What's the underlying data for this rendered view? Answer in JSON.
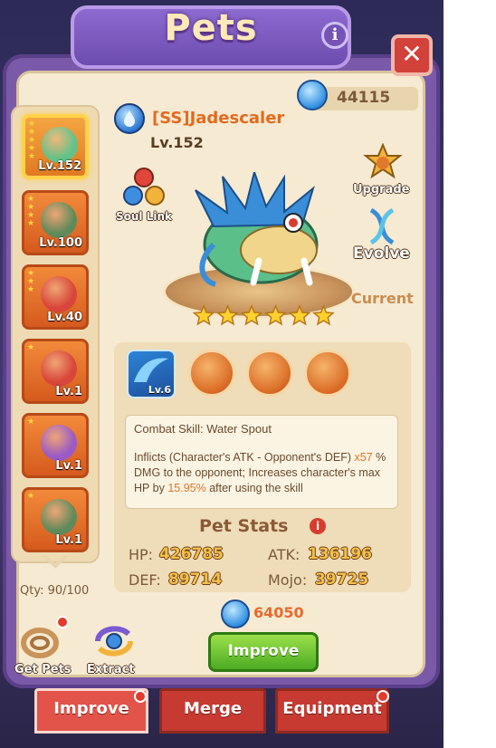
{
  "header": {
    "title": "Pets"
  },
  "currency": {
    "amount": "44115"
  },
  "pet": {
    "name": "[SS]Jadescaler",
    "level": "Lv.152",
    "status": "Current",
    "star_count": 6
  },
  "actions": {
    "soul_link": "Soul Link",
    "upgrade": "Upgrade",
    "evolve": "Evolve"
  },
  "pet_list": {
    "items": [
      {
        "level": "Lv.152",
        "stars": 5,
        "selected": true
      },
      {
        "level": "Lv.100",
        "stars": 4,
        "selected": false
      },
      {
        "level": "Lv.40",
        "stars": 3,
        "selected": false
      },
      {
        "level": "Lv.1",
        "stars": 1,
        "selected": false
      },
      {
        "level": "Lv.1",
        "stars": 1,
        "selected": false
      },
      {
        "level": "Lv.1",
        "stars": 1,
        "selected": false
      }
    ],
    "qty": "Qty: 90/100"
  },
  "skill": {
    "main_level": "Lv.6",
    "title": "Combat Skill: Water Spout",
    "desc_part1": "Inflicts (Character's ATK - Opponent's DEF)",
    "desc_highlight1": "x57",
    "desc_part2": "% DMG to the opponent; Increases character's max HP by",
    "desc_highlight2": "15.95%",
    "desc_part3": "after using the skill"
  },
  "stats": {
    "title": "Pet Stats",
    "hp_label": "HP:",
    "hp": "426785",
    "atk_label": "ATK:",
    "atk": "136196",
    "def_label": "DEF:",
    "def": "89714",
    "mojo_label": "Mojo:",
    "mojo": "39725"
  },
  "improve": {
    "cost": "64050",
    "button": "Improve"
  },
  "bottom_actions": {
    "get_pets": "Get Pets",
    "extract": "Extract"
  },
  "tabs": [
    {
      "label": "Improve",
      "active": true
    },
    {
      "label": "Merge",
      "active": false
    },
    {
      "label": "Equipment",
      "active": false
    }
  ]
}
